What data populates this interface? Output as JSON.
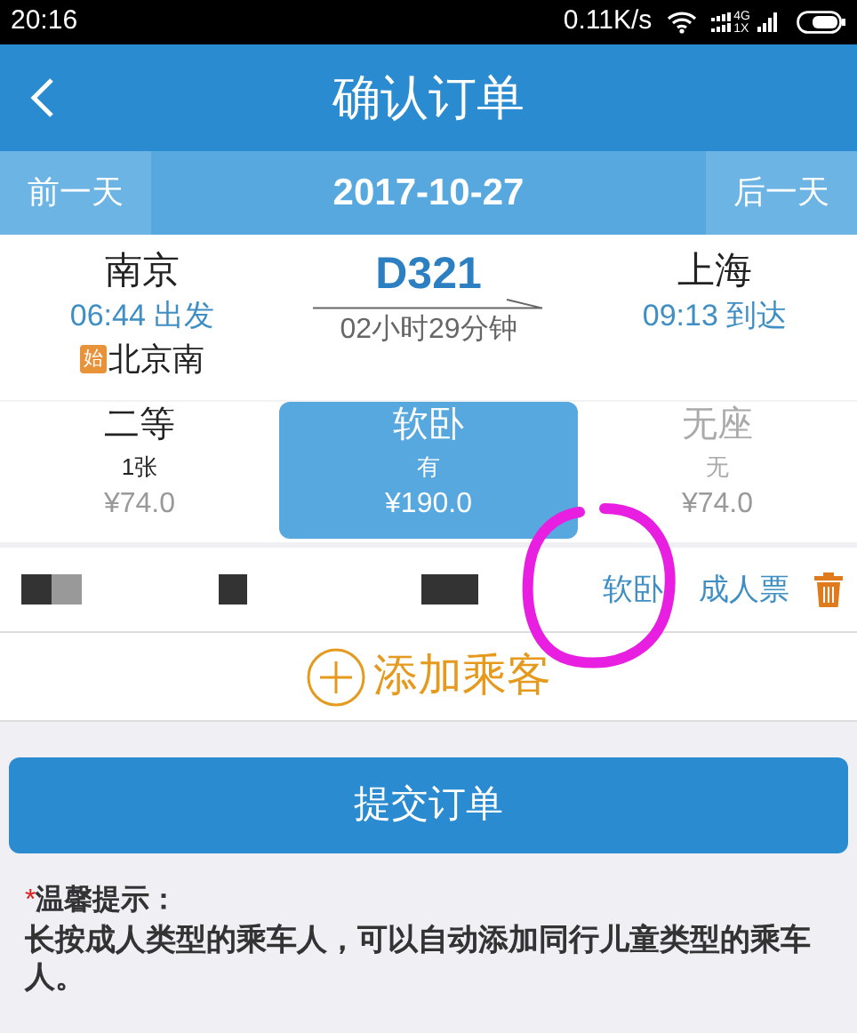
{
  "status_bar": {
    "time": "20:16",
    "speed": "0.11K/s",
    "network_top": "4G",
    "network_bottom": "1X"
  },
  "header": {
    "title": "确认订单"
  },
  "date_bar": {
    "prev": "前一天",
    "date": "2017-10-27",
    "next": "后一天"
  },
  "train": {
    "from": "南京",
    "depart": "06:44 出发",
    "origin_badge": "始",
    "origin": "北京南",
    "number": "D321",
    "duration": "02小时29分钟",
    "to": "上海",
    "arrive": "09:13 到达"
  },
  "seats": [
    {
      "name": "二等",
      "count": "1张",
      "price": "¥74.0",
      "selected": false,
      "disabled": false
    },
    {
      "name": "软卧",
      "count": "有",
      "price": "¥190.0",
      "selected": true,
      "disabled": false
    },
    {
      "name": "无座",
      "count": "无",
      "price": "¥74.0",
      "selected": false,
      "disabled": true
    }
  ],
  "passengers": [
    {
      "seat": "软卧",
      "ticket_type": "成人票"
    }
  ],
  "add_passenger": "添加乘客",
  "submit": "提交订单",
  "tip": {
    "mark": "*",
    "title": "温馨提示：",
    "text": "长按成人类型的乘车人，可以自动添加同行儿童类型的乘车人。"
  }
}
